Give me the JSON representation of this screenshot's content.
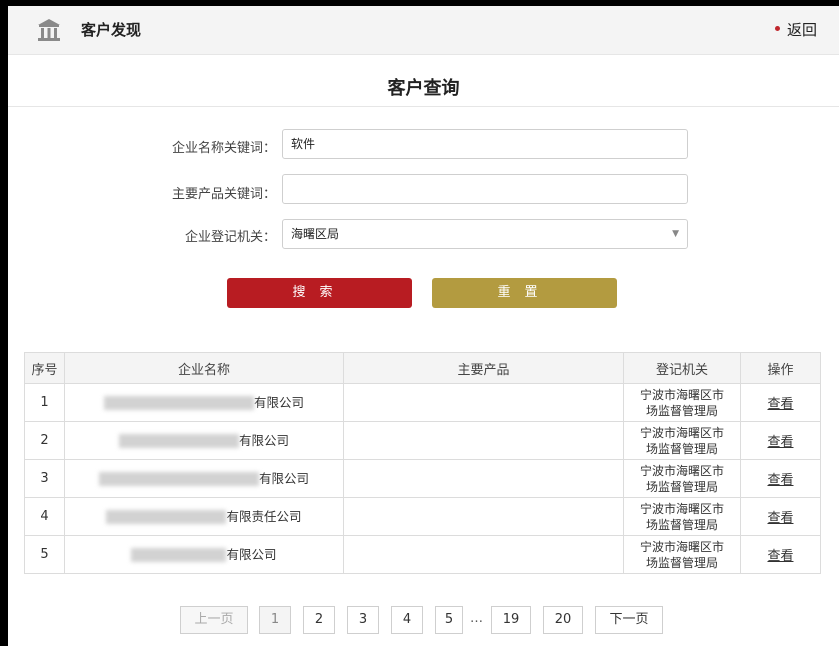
{
  "header": {
    "title": "客户发现",
    "back_label": "返回"
  },
  "page": {
    "title": "客户查询"
  },
  "form": {
    "company_keyword": {
      "label": "企业名称关键词：",
      "value": "软件"
    },
    "product_keyword": {
      "label": "主要产品关键词：",
      "value": ""
    },
    "authority": {
      "label": "企业登记机关：",
      "value": "海曙区局"
    },
    "search_label": "搜索",
    "reset_label": "重置"
  },
  "table": {
    "headers": [
      "序号",
      "企业名称",
      "主要产品",
      "登记机关",
      "操作"
    ],
    "rows": [
      {
        "index": "1",
        "name_suffix": "有限公司",
        "product": "",
        "authority_line1": "宁波市海曙区市",
        "authority_line2": "场监督管理局",
        "action": "查看"
      },
      {
        "index": "2",
        "name_suffix": "有限公司",
        "product": "",
        "authority_line1": "宁波市海曙区市",
        "authority_line2": "场监督管理局",
        "action": "查看"
      },
      {
        "index": "3",
        "name_suffix": "有限公司",
        "product": "",
        "authority_line1": "宁波市海曙区市",
        "authority_line2": "场监督管理局",
        "action": "查看"
      },
      {
        "index": "4",
        "name_suffix": "有限责任公司",
        "product": "",
        "authority_line1": "宁波市海曙区市",
        "authority_line2": "场监督管理局",
        "action": "查看"
      },
      {
        "index": "5",
        "name_suffix": "有限公司",
        "product": "",
        "authority_line1": "宁波市海曙区市",
        "authority_line2": "场监督管理局",
        "action": "查看"
      }
    ]
  },
  "pagination": {
    "prev_label": "上一页",
    "next_label": "下一页",
    "pages": [
      "1",
      "2",
      "3",
      "4",
      "5"
    ],
    "ellipsis": "…",
    "tail_pages": [
      "19",
      "20"
    ],
    "current": "1"
  },
  "colors": {
    "search_button": "#b81c22",
    "reset_button": "#b39b40",
    "accent_dot": "#c0272d"
  },
  "icons": {
    "logo": "bank-building-icon",
    "select_arrow": "triangle-down-icon"
  }
}
